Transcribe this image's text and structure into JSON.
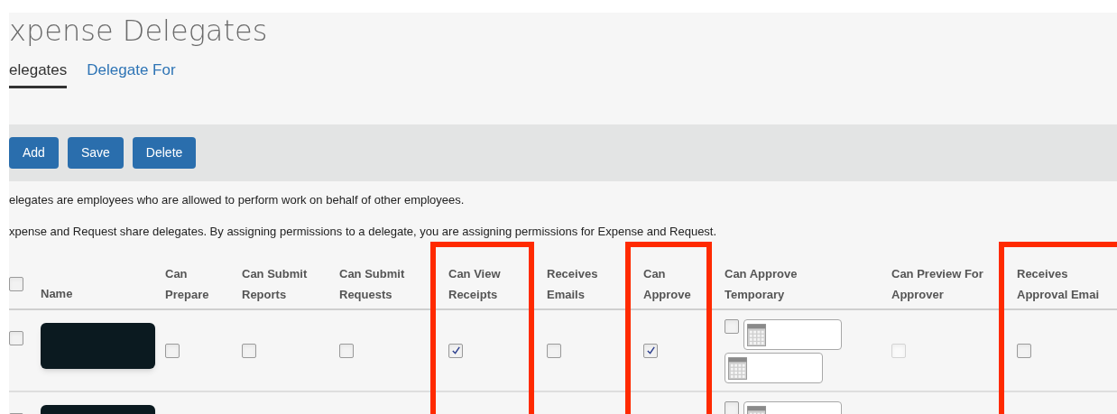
{
  "page_title": "xpense Delegates",
  "tabs": [
    {
      "label": "elegates",
      "selected": true
    },
    {
      "label": "Delegate For",
      "selected": false
    }
  ],
  "toolbar": {
    "buttons": [
      "Add",
      "Save",
      "Delete"
    ]
  },
  "notes": [
    "elegates are employees who are allowed to perform work on behalf of other employees.",
    "xpense and Request share delegates. By assigning permissions to a delegate, you are assigning permissions for Expense and Request."
  ],
  "table": {
    "select_all": {
      "checked": false
    },
    "columns": [
      {
        "label": "Name",
        "highlighted": false
      },
      {
        "label": "Can Prepare",
        "highlighted": false
      },
      {
        "label": "Can Submit Reports",
        "highlighted": false
      },
      {
        "label": "Can Submit Requests",
        "highlighted": false
      },
      {
        "label": "Can View Receipts",
        "highlighted": true
      },
      {
        "label": "Receives Emails",
        "highlighted": false
      },
      {
        "label": "Can Approve",
        "highlighted": true
      },
      {
        "label": "Can Approve Temporary",
        "highlighted": false
      },
      {
        "label": "Can Preview For Approver",
        "highlighted": false
      },
      {
        "label": "Receives Approval Emai",
        "highlighted": true
      }
    ],
    "rows": [
      {
        "checked": false,
        "cells": [
          {
            "kind": "redacted"
          },
          {
            "kind": "checkbox",
            "checked": false,
            "disabled": false
          },
          {
            "kind": "checkbox",
            "checked": false,
            "disabled": false
          },
          {
            "kind": "checkbox",
            "checked": false,
            "disabled": false
          },
          {
            "kind": "checkbox",
            "checked": true,
            "disabled": false
          },
          {
            "kind": "checkbox",
            "checked": false,
            "disabled": false
          },
          {
            "kind": "checkbox",
            "checked": true,
            "disabled": false
          },
          {
            "kind": "temporary",
            "checked": false,
            "date_fields": [
              {
                "kind": "date"
              },
              {
                "kind": "date"
              }
            ]
          },
          {
            "kind": "checkbox",
            "checked": false,
            "disabled": true
          },
          {
            "kind": "checkbox",
            "checked": false,
            "disabled": false
          }
        ]
      },
      {
        "checked": false,
        "cells": [
          {
            "kind": "redacted"
          },
          {
            "kind": "blank"
          },
          {
            "kind": "blank"
          },
          {
            "kind": "blank"
          },
          {
            "kind": "blank"
          },
          {
            "kind": "blank"
          },
          {
            "kind": "blank"
          },
          {
            "kind": "temporary",
            "checked": false,
            "date_fields": [
              {
                "kind": "date"
              }
            ]
          },
          {
            "kind": "blank"
          },
          {
            "kind": "blank"
          }
        ]
      }
    ]
  }
}
